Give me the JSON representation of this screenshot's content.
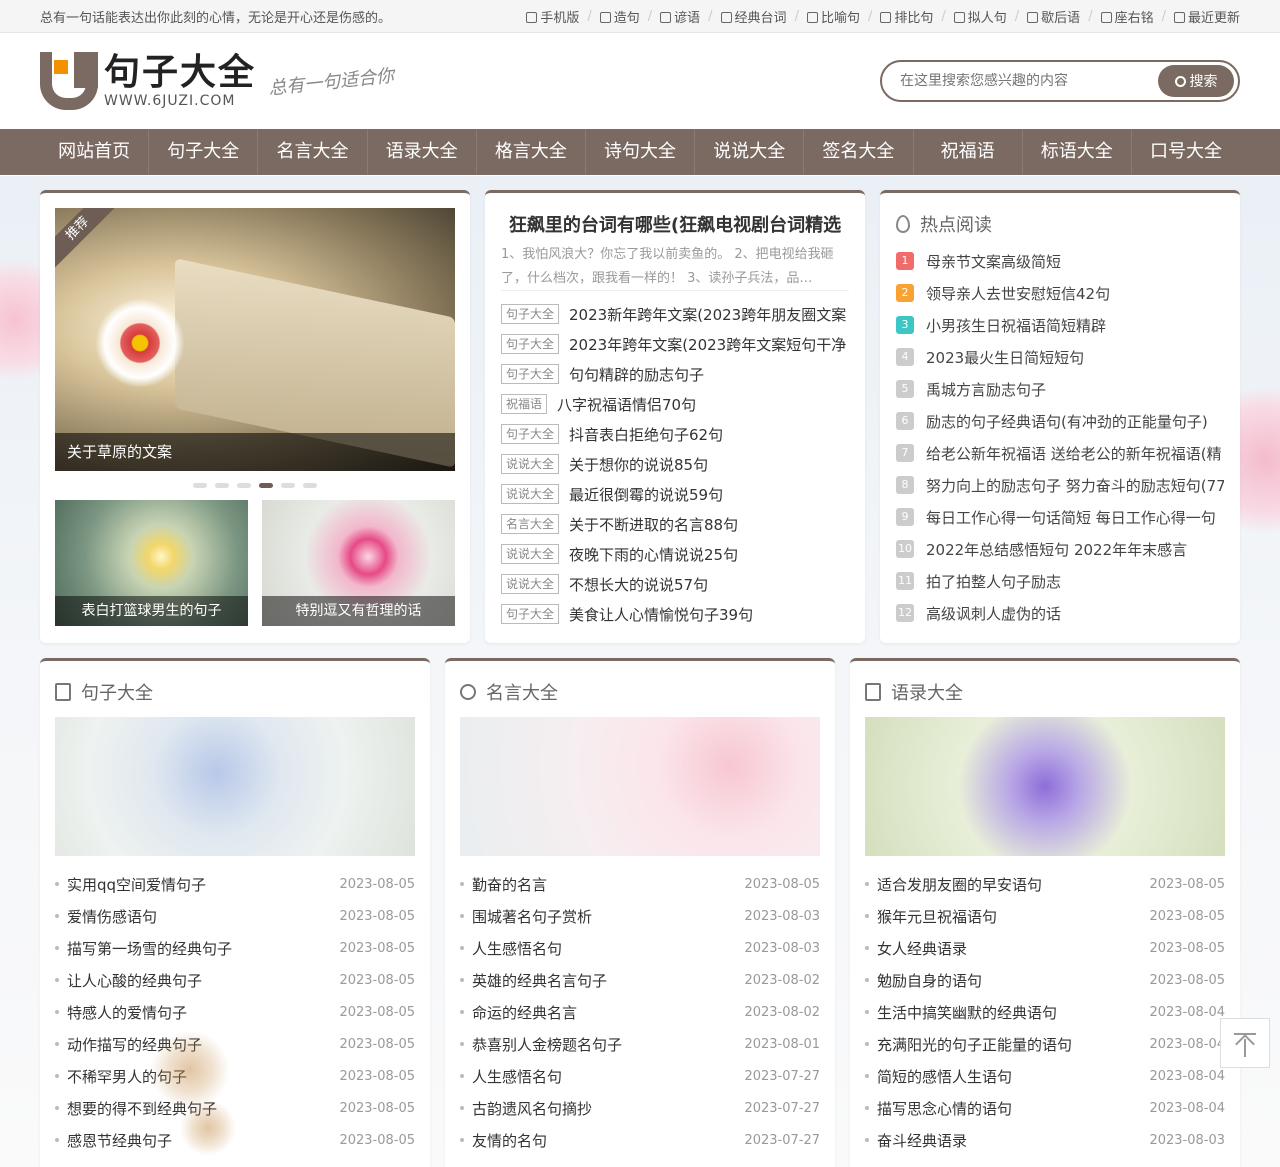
{
  "topbar": {
    "slogan": "总有一句话能表达出你此刻的心情，无论是开心还是伤感的。",
    "links": [
      {
        "icon": "phone-icon",
        "label": "手机版"
      },
      {
        "icon": "pencil-icon",
        "label": "造句"
      },
      {
        "icon": "book-icon",
        "label": "谚语"
      },
      {
        "icon": "chat-icon",
        "label": "经典台词"
      },
      {
        "icon": "page-icon",
        "label": "比喻句"
      },
      {
        "icon": "list-icon",
        "label": "排比句"
      },
      {
        "icon": "users-icon",
        "label": "拟人句"
      },
      {
        "icon": "audio-icon",
        "label": "歇后语"
      },
      {
        "icon": "layers-icon",
        "label": "座右铭"
      },
      {
        "icon": "doc-icon",
        "label": "最近更新"
      }
    ]
  },
  "header": {
    "logo_title": "句子大全",
    "logo_url_text": "WWW.6JUZI.COM",
    "logo_slogan": "总有一句适合你",
    "search_placeholder": "在这里搜索您感兴趣的内容",
    "search_button": "搜索"
  },
  "nav": [
    "网站首页",
    "句子大全",
    "名言大全",
    "语录大全",
    "格言大全",
    "诗句大全",
    "说说大全",
    "签名大全",
    "祝福语",
    "标语大全",
    "口号大全"
  ],
  "slider": {
    "tag": "推荐",
    "caption": "关于草原的文案",
    "dots": 6,
    "active_dot": 4,
    "thumbs": [
      {
        "caption": "表白打篮球男生的句子"
      },
      {
        "caption": "特别逗又有哲理的话"
      }
    ]
  },
  "featured": {
    "title": "狂飙里的台词有哪些(狂飙电视剧台词精选",
    "summary": "1、我怕风浪大？你忘了我以前卖鱼的。 2、把电视给我砸了，什么档次，跟我看一样的！ 3、读孙子兵法，品…",
    "items": [
      {
        "cat": "句子大全",
        "title": "2023新年跨年文案(2023跨年朋友圈文案"
      },
      {
        "cat": "句子大全",
        "title": "2023年跨年文案(2023跨年文案短句干净"
      },
      {
        "cat": "句子大全",
        "title": "句句精辟的励志句子"
      },
      {
        "cat": "祝福语",
        "title": "八字祝福语情侣70句"
      },
      {
        "cat": "句子大全",
        "title": "抖音表白拒绝句子62句"
      },
      {
        "cat": "说说大全",
        "title": "关于想你的说说85句"
      },
      {
        "cat": "说说大全",
        "title": "最近很倒霉的说说59句"
      },
      {
        "cat": "名言大全",
        "title": "关于不断进取的名言88句"
      },
      {
        "cat": "说说大全",
        "title": "夜晚下雨的心情说说25句"
      },
      {
        "cat": "说说大全",
        "title": "不想长大的说说57句"
      },
      {
        "cat": "句子大全",
        "title": "美食让人心情愉悦句子39句"
      }
    ]
  },
  "hot": {
    "title": "热点阅读",
    "items": [
      {
        "n": "1",
        "title": "母亲节文案高级简短"
      },
      {
        "n": "2",
        "title": "领导亲人去世安慰短信42句"
      },
      {
        "n": "3",
        "title": "小男孩生日祝福语简短精辟"
      },
      {
        "n": "4",
        "title": "2023最火生日简短短句"
      },
      {
        "n": "5",
        "title": "禹城方言励志句子"
      },
      {
        "n": "6",
        "title": "励志的句子经典语句(有冲劲的正能量句子)"
      },
      {
        "n": "7",
        "title": "给老公新年祝福语 送给老公的新年祝福语(精"
      },
      {
        "n": "8",
        "title": "努力向上的励志句子 努力奋斗的励志短句(77"
      },
      {
        "n": "9",
        "title": "每日工作心得一句话简短 每日工作心得一句"
      },
      {
        "n": "10",
        "title": "2022年总结感悟短句 2022年年末感言"
      },
      {
        "n": "11",
        "title": "拍了拍整人句子励志"
      },
      {
        "n": "12",
        "title": "高级讽刺人虚伪的话"
      }
    ]
  },
  "columns": [
    {
      "icon": "document-icon",
      "title": "句子大全",
      "items": [
        {
          "t": "实用qq空间爱情句子",
          "d": "2023-08-05"
        },
        {
          "t": "爱情伤感语句",
          "d": "2023-08-05"
        },
        {
          "t": "描写第一场雪的经典句子",
          "d": "2023-08-05"
        },
        {
          "t": "让人心酸的经典句子",
          "d": "2023-08-05"
        },
        {
          "t": "特感人的爱情句子",
          "d": "2023-08-05"
        },
        {
          "t": "动作描写的经典句子",
          "d": "2023-08-05"
        },
        {
          "t": "不稀罕男人的句子",
          "d": "2023-08-05"
        },
        {
          "t": "想要的得不到经典句子",
          "d": "2023-08-05"
        },
        {
          "t": "感恩节经典句子",
          "d": "2023-08-05"
        }
      ]
    },
    {
      "icon": "user-icon",
      "title": "名言大全",
      "items": [
        {
          "t": "勤奋的名言",
          "d": "2023-08-05"
        },
        {
          "t": "围城著名句子赏析",
          "d": "2023-08-03"
        },
        {
          "t": "人生感悟名句",
          "d": "2023-08-03"
        },
        {
          "t": "英雄的经典名言句子",
          "d": "2023-08-02"
        },
        {
          "t": "命运的经典名言",
          "d": "2023-08-02"
        },
        {
          "t": "恭喜别人金榜题名句子",
          "d": "2023-08-01"
        },
        {
          "t": "人生感悟名句",
          "d": "2023-07-27"
        },
        {
          "t": "古韵遗风名句摘抄",
          "d": "2023-07-27"
        },
        {
          "t": "友情的名句",
          "d": "2023-07-27"
        }
      ]
    },
    {
      "icon": "message-icon",
      "title": "语录大全",
      "items": [
        {
          "t": "适合发朋友圈的早安语句",
          "d": "2023-08-05"
        },
        {
          "t": "猴年元旦祝福语句",
          "d": "2023-08-05"
        },
        {
          "t": "女人经典语录",
          "d": "2023-08-05"
        },
        {
          "t": "勉励自身的语句",
          "d": "2023-08-05"
        },
        {
          "t": "生活中搞笑幽默的经典语句",
          "d": "2023-08-04"
        },
        {
          "t": "充满阳光的句子正能量的语句",
          "d": "2023-08-04"
        },
        {
          "t": "简短的感悟人生语句",
          "d": "2023-08-04"
        },
        {
          "t": "描写思念心情的语句",
          "d": "2023-08-04"
        },
        {
          "t": "奋斗经典语录",
          "d": "2023-08-03"
        }
      ]
    }
  ]
}
